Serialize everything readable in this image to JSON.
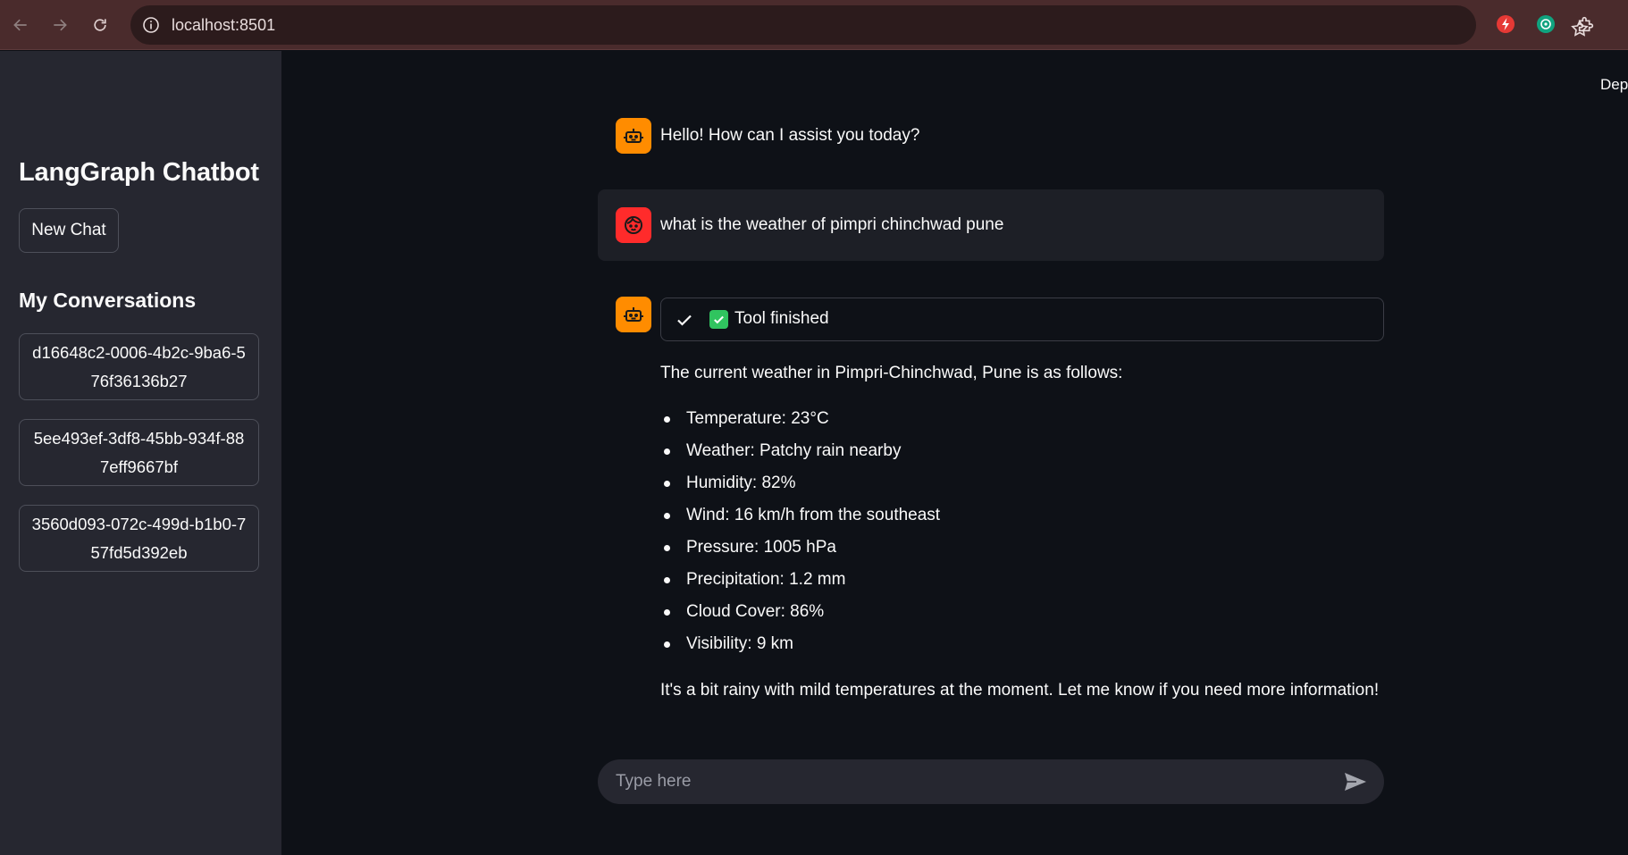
{
  "browser": {
    "url": "localhost:8501"
  },
  "sidebar": {
    "title": "LangGraph Chatbot",
    "new_chat_label": "New Chat",
    "section_title": "My Conversations",
    "conversations": [
      {
        "label": "d16648c2-0006-4b2c-9ba6-576f36136b27"
      },
      {
        "label": "5ee493ef-3df8-45bb-934f-887eff9667bf"
      },
      {
        "label": "3560d093-072c-499d-b1b0-757fd5d392eb"
      }
    ]
  },
  "header": {
    "deploy_label": "Dep"
  },
  "chat": {
    "greeting": "Hello! How can I assist you today?",
    "user_message": "what is the weather of pimpri chinchwad pune",
    "tool_status": "Tool finished",
    "reply_intro": "The current weather in Pimpri-Chinchwad, Pune is as follows:",
    "reply_items": [
      "Temperature: 23°C",
      "Weather: Patchy rain nearby",
      "Humidity: 82%",
      "Wind: 16 km/h from the southeast",
      "Pressure: 1005 hPa",
      "Precipitation: 1.2 mm",
      "Cloud Cover: 86%",
      "Visibility: 9 km"
    ],
    "reply_outro": "It's a bit rainy with mild temperatures at the moment. Let me know if you need more information!"
  },
  "input": {
    "placeholder": "Type here"
  },
  "colors": {
    "bot_avatar": "#ff8c00",
    "user_avatar": "#ff2b2b",
    "background": "#0e1117",
    "sidebar": "#262730"
  }
}
